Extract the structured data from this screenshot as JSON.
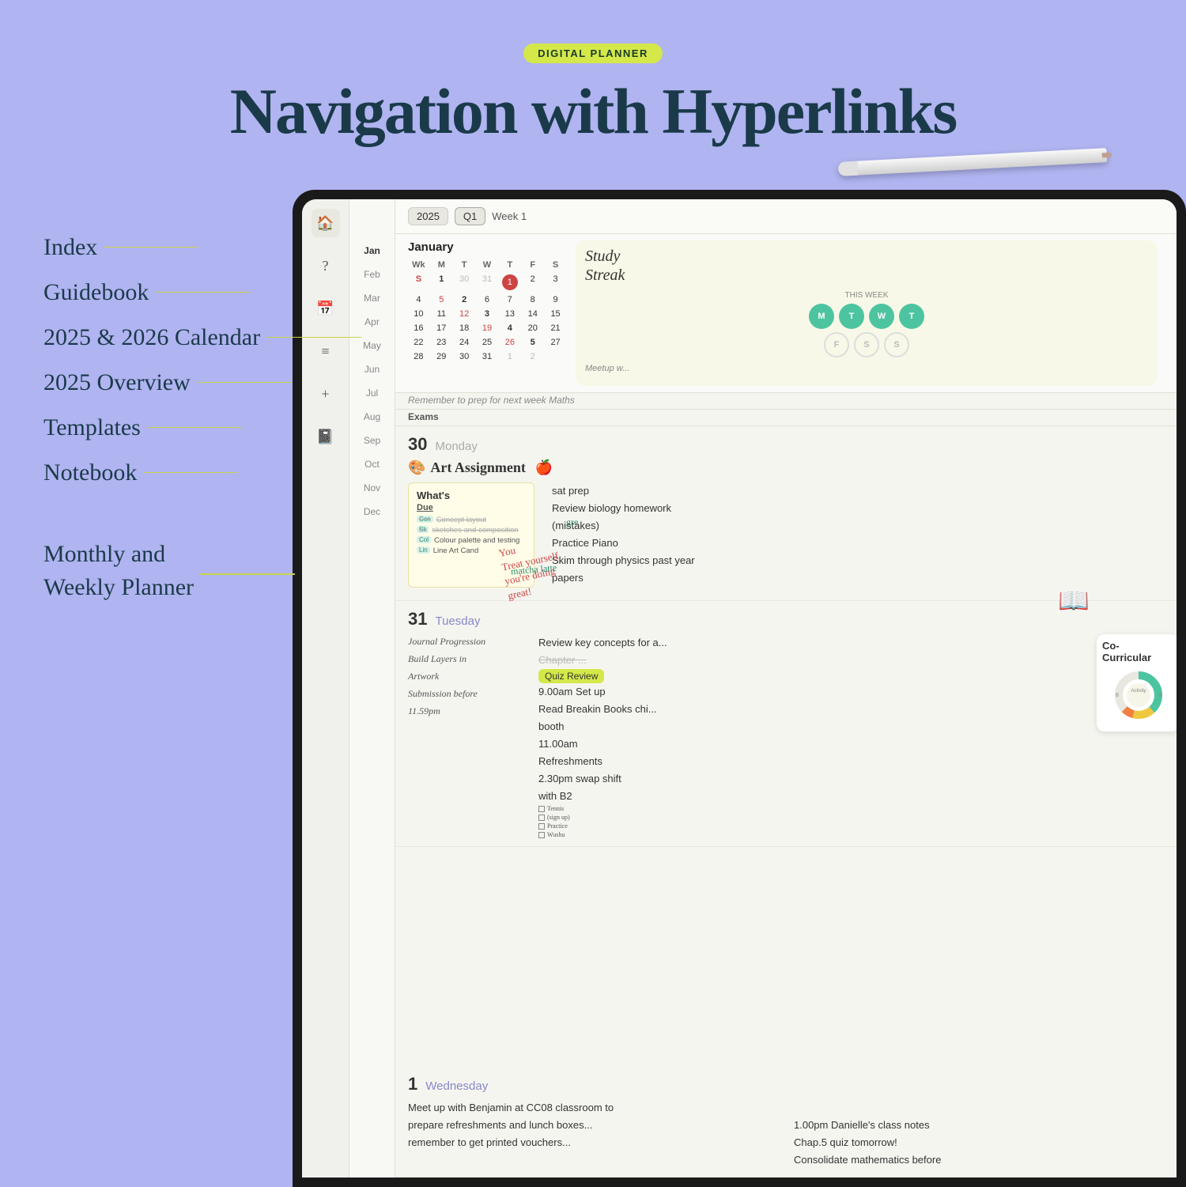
{
  "badge": {
    "label": "DIGITAL PLANNER"
  },
  "title": "Navigation with Hyperlinks",
  "left_nav": {
    "items": [
      {
        "label": "Index",
        "connector": true
      },
      {
        "label": "Guidebook",
        "connector": true
      },
      {
        "label": "2025 & 2026 Calendar",
        "connector": true
      },
      {
        "label": "2025 Overview",
        "connector": true
      },
      {
        "label": "Templates",
        "connector": true
      },
      {
        "label": "Notebook",
        "connector": true
      },
      {
        "label": "Monthly and\nWeekly Planner",
        "connector": true
      }
    ]
  },
  "top_nav": {
    "year": "2025",
    "quarter": "Q1",
    "week": "Week 1"
  },
  "calendar": {
    "month": "January",
    "headers": [
      "Wk",
      "M",
      "T",
      "W",
      "T",
      "F",
      "S",
      "S"
    ],
    "weeks": [
      {
        "wk": "1",
        "days": [
          "30",
          "31",
          "1",
          "2",
          "3",
          "4",
          "5"
        ]
      },
      {
        "wk": "2",
        "days": [
          "6",
          "7",
          "8",
          "9",
          "10",
          "11",
          "12"
        ]
      },
      {
        "wk": "3",
        "days": [
          "13",
          "14",
          "15",
          "16",
          "17",
          "18",
          "19"
        ]
      },
      {
        "wk": "4",
        "days": [
          "20",
          "21",
          "22",
          "23",
          "24",
          "25",
          "26"
        ]
      },
      {
        "wk": "5",
        "days": [
          "27",
          "28",
          "29",
          "30",
          "31",
          "1",
          "2"
        ]
      }
    ]
  },
  "study_streak": {
    "title": "Study\nStreak",
    "this_week": "THIS WEEK",
    "days_row1": [
      "M",
      "T",
      "W",
      "T"
    ],
    "days_row2": [
      "F",
      "S",
      "S"
    ]
  },
  "reminders": [
    "Meetup w...",
    "Remember to prep for next week Maths"
  ],
  "day_entries": [
    {
      "number": "30",
      "name": "Monday",
      "name_color": "gray",
      "art_assignment": "Art Assignment",
      "apple": "🍎",
      "palette": "🎨",
      "whats_due": {
        "title": "What's",
        "subtitle": "Due",
        "items": [
          {
            "label": "Con",
            "text": "Concept layout",
            "done": true
          },
          {
            "label": "Sk",
            "text": "sketches and composition",
            "done": true
          },
          {
            "label": "Col",
            "text": "Colour palette and testing",
            "done": false
          },
          {
            "label": "Lin",
            "text": "Line Art Cand",
            "done": false
          }
        ]
      },
      "tasks": [
        "sat prep",
        "Review biology homework",
        "(mistakes)",
        "Practice Piano",
        "Skim through physics past year",
        "papers"
      ]
    },
    {
      "number": "31",
      "name": "Tuesday",
      "name_color": "purple",
      "notes": [
        "Journal Progression",
        "Build Layers in",
        "Artwork",
        "Submission before",
        "11.59pm"
      ],
      "tasks": [
        "Review key concepts for a...",
        "Chapter ...",
        "9.00am Set up",
        "Read Breakin Books chi...",
        "booth",
        "11.00am",
        "Refreshments",
        "2.30pm swap shift",
        "with B2"
      ],
      "quiz_badge": "Quiz Review"
    },
    {
      "number": "1",
      "name": "Wednesday",
      "name_color": "purple",
      "notes": [
        "Meet up with Benjamin at CC08 classroom to",
        "prepare refreshments and lunch boxes...",
        "remember to get printed vouchers..."
      ],
      "tasks": [
        "1.00pm Danielle's class notes",
        "Chap.5 quiz tomorrow!",
        "Consolidate mathematics before"
      ]
    }
  ],
  "month_nav": [
    "Jan",
    "Feb",
    "Mar",
    "Apr",
    "May",
    "Jun",
    "Jul",
    "Aug",
    "Sep",
    "Oct",
    "Nov",
    "Dec"
  ],
  "co_curricular": {
    "title": "Co-\nCurricular",
    "activity_label": "Activity",
    "checklist": [
      "Tennis",
      "(sign up)",
      "Practice",
      "Wushu"
    ]
  },
  "annotations": {
    "handwritten1": "You\nTreat yourself\nyou're doing\ngreat!",
    "handwritten2": "gre",
    "handwritten3": "matcha latte"
  }
}
